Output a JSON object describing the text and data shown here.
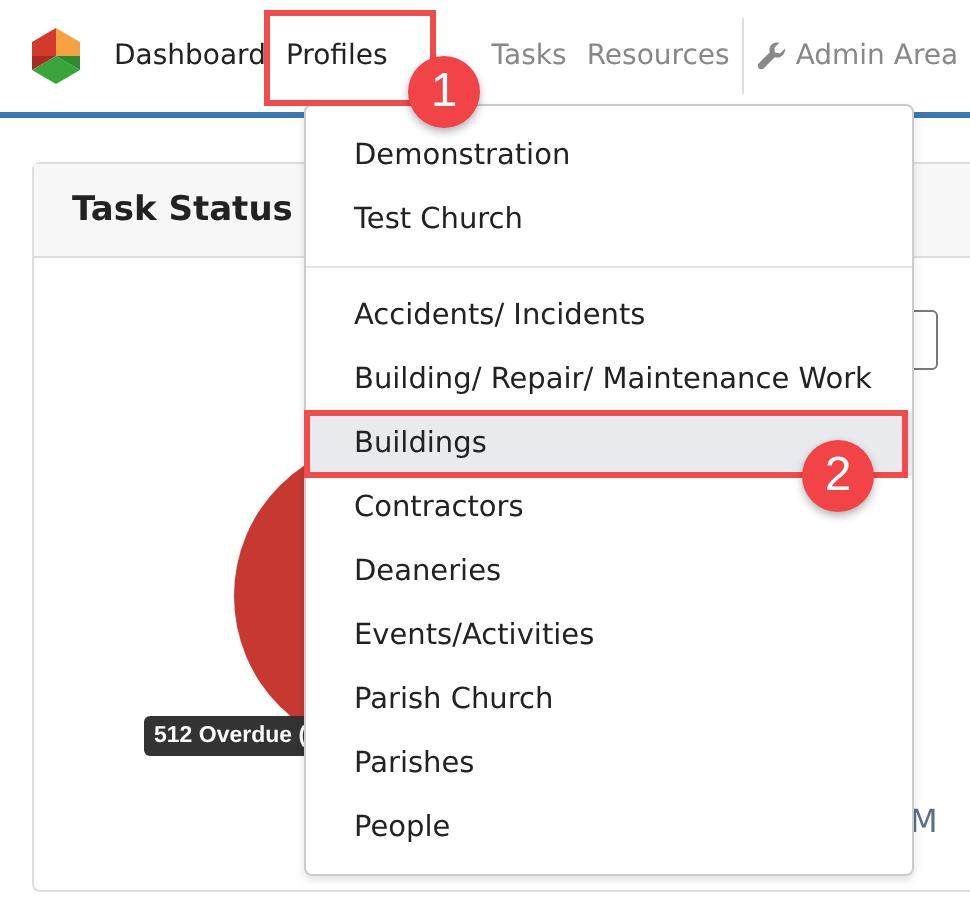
{
  "nav": [
    {
      "label": "Dashboard",
      "dimmed": false,
      "kind": "link"
    },
    {
      "label": "Profiles",
      "dimmed": false,
      "kind": "link"
    },
    {
      "label": "Tasks",
      "dimmed": true,
      "kind": "link"
    },
    {
      "label": "Resources",
      "dimmed": true,
      "kind": "link"
    },
    {
      "label": "Admin Area",
      "dimmed": true,
      "kind": "admin"
    }
  ],
  "card": {
    "title": "Task Status",
    "tooltip": "512 Overdue (",
    "edge_text": "M"
  },
  "menu": {
    "groups": [
      [
        {
          "label": "Demonstration",
          "selected": false
        },
        {
          "label": "Test Church",
          "selected": false
        }
      ],
      [
        {
          "label": "Accidents/ Incidents",
          "selected": false
        },
        {
          "label": "Building/ Repair/ Maintenance Work",
          "selected": false
        },
        {
          "label": "Buildings",
          "selected": true
        },
        {
          "label": "Contractors",
          "selected": false
        },
        {
          "label": "Deaneries",
          "selected": false
        },
        {
          "label": "Events/Activities",
          "selected": false
        },
        {
          "label": "Parish Church",
          "selected": false
        },
        {
          "label": "Parishes",
          "selected": false
        },
        {
          "label": "People",
          "selected": false
        }
      ]
    ]
  },
  "callouts": [
    {
      "label": "1"
    },
    {
      "label": "2"
    }
  ]
}
